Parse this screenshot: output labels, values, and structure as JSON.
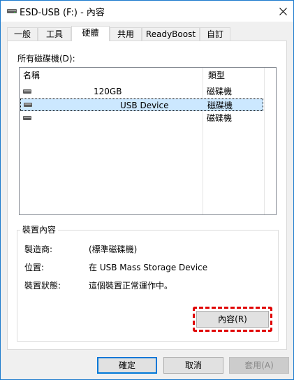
{
  "window": {
    "title": "ESD-USB (F:) - 內容"
  },
  "tabs": [
    {
      "label": "一般"
    },
    {
      "label": "工具"
    },
    {
      "label": "硬體"
    },
    {
      "label": "共用"
    },
    {
      "label": "ReadyBoost"
    },
    {
      "label": "自訂"
    }
  ],
  "active_tab": "硬體",
  "drives_label": "所有磁碟機(D):",
  "list": {
    "headers": {
      "name": "名稱",
      "type": "類型"
    },
    "rows": [
      {
        "name": "120GB",
        "type": "磁碟機",
        "selected": false
      },
      {
        "name": "USB Device",
        "type": "磁碟機",
        "selected": true
      },
      {
        "name": "",
        "type": "磁碟機",
        "selected": false
      }
    ]
  },
  "device_properties": {
    "title": "裝置內容",
    "manufacturer_label": "製造商:",
    "manufacturer_value": "(標準磁碟機)",
    "location_label": "位置:",
    "location_value": "在 USB Mass Storage Device",
    "status_label": "裝置狀態:",
    "status_value": "這個裝置正常運作中。",
    "properties_button": "內容(R)"
  },
  "footer": {
    "ok": "確定",
    "cancel": "取消",
    "apply": "套用(A)"
  },
  "icons": {
    "title": "drive-icon",
    "close": "close-icon",
    "row": "disk-drive-icon"
  },
  "colors": {
    "window_border": "#1c7acd",
    "selection": "#cce8ff",
    "highlight": "#e00000",
    "default_button": "#0078d7"
  }
}
